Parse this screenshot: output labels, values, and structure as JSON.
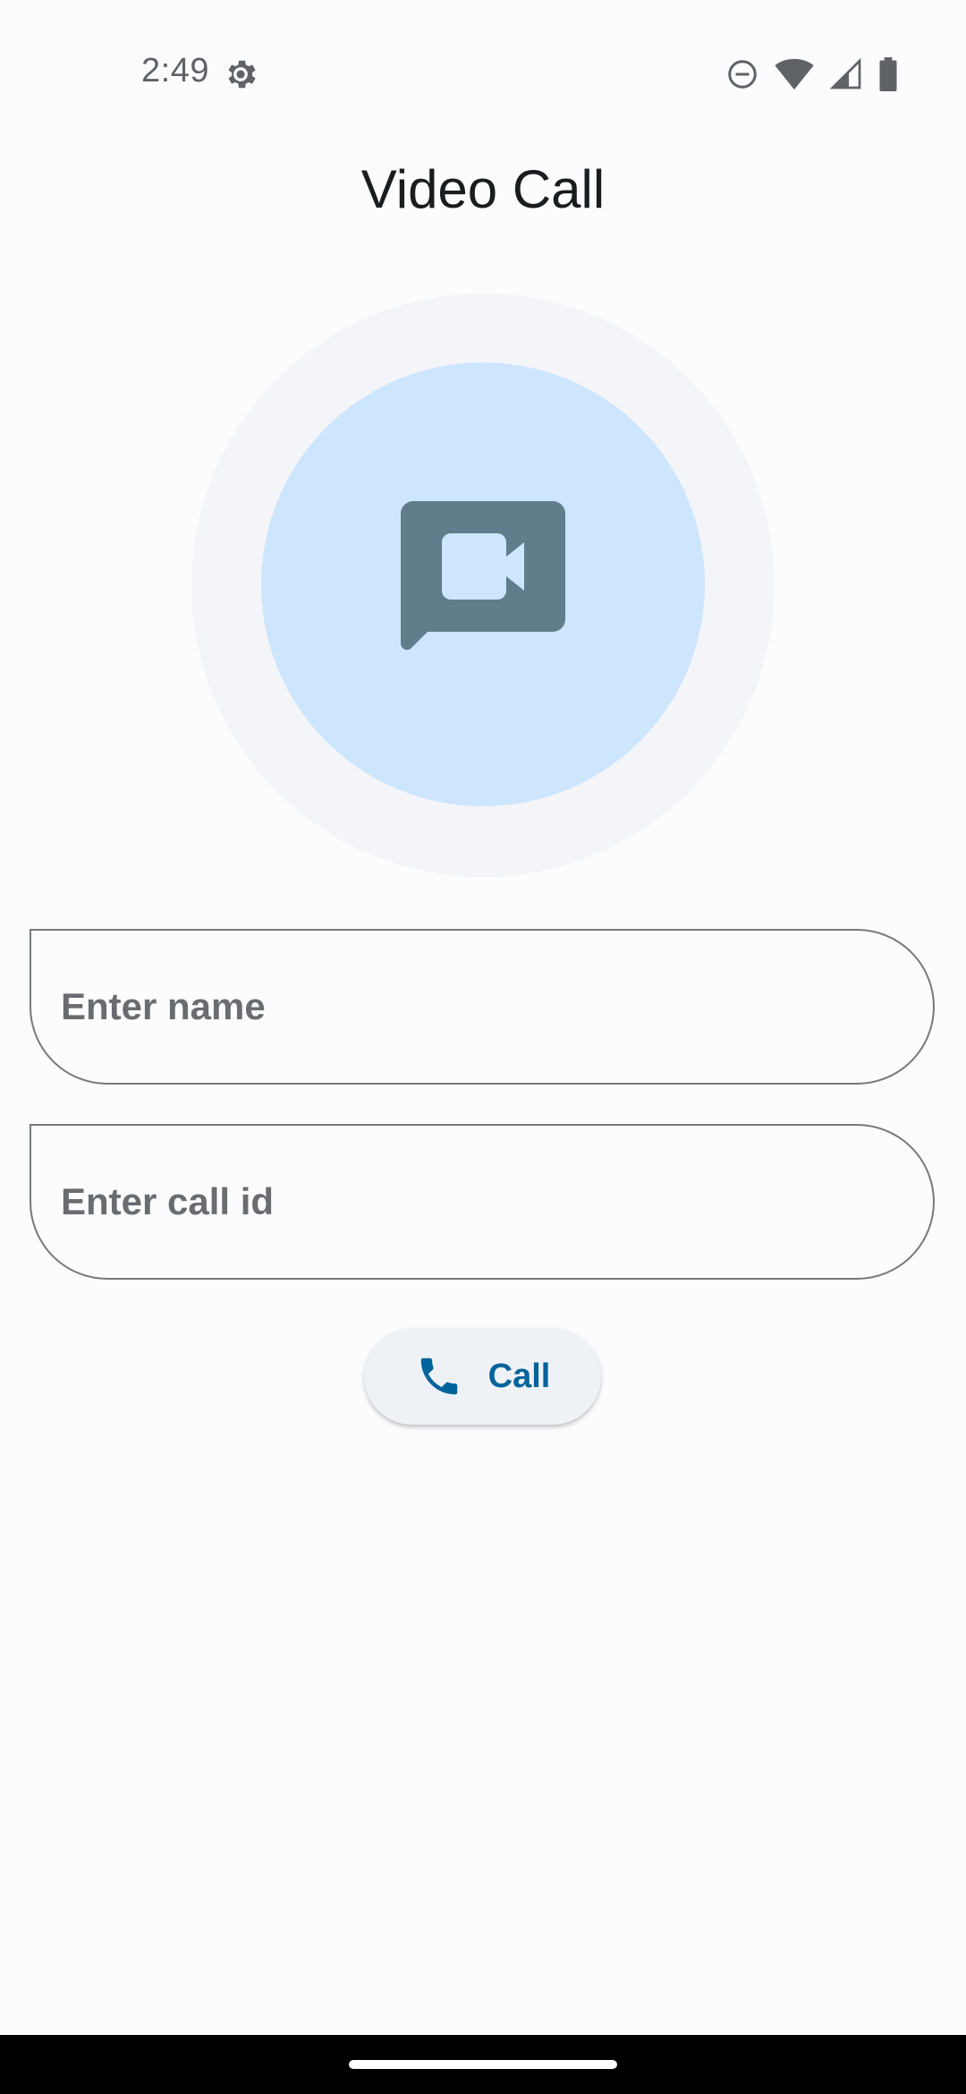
{
  "status_bar": {
    "time": "2:49",
    "icons": [
      "settings-gear-icon",
      "do-not-disturb-icon",
      "wifi-icon",
      "cell-signal-icon",
      "battery-icon"
    ]
  },
  "app": {
    "title": "Video Call",
    "hero_icon": "video-chat-icon"
  },
  "form": {
    "name_placeholder": "Enter name",
    "name_value": "",
    "call_id_placeholder": "Enter call id",
    "call_id_value": ""
  },
  "call_button": {
    "label": "Call",
    "icon": "phone-icon"
  },
  "colors": {
    "background": "#fcfcff",
    "outer_circle": "#f4f5f9",
    "inner_circle": "#cde5fd",
    "hero_icon": "#607d8b",
    "field_outline": "#77797d",
    "button_bg": "#eef2f7",
    "accent": "#00639b"
  }
}
